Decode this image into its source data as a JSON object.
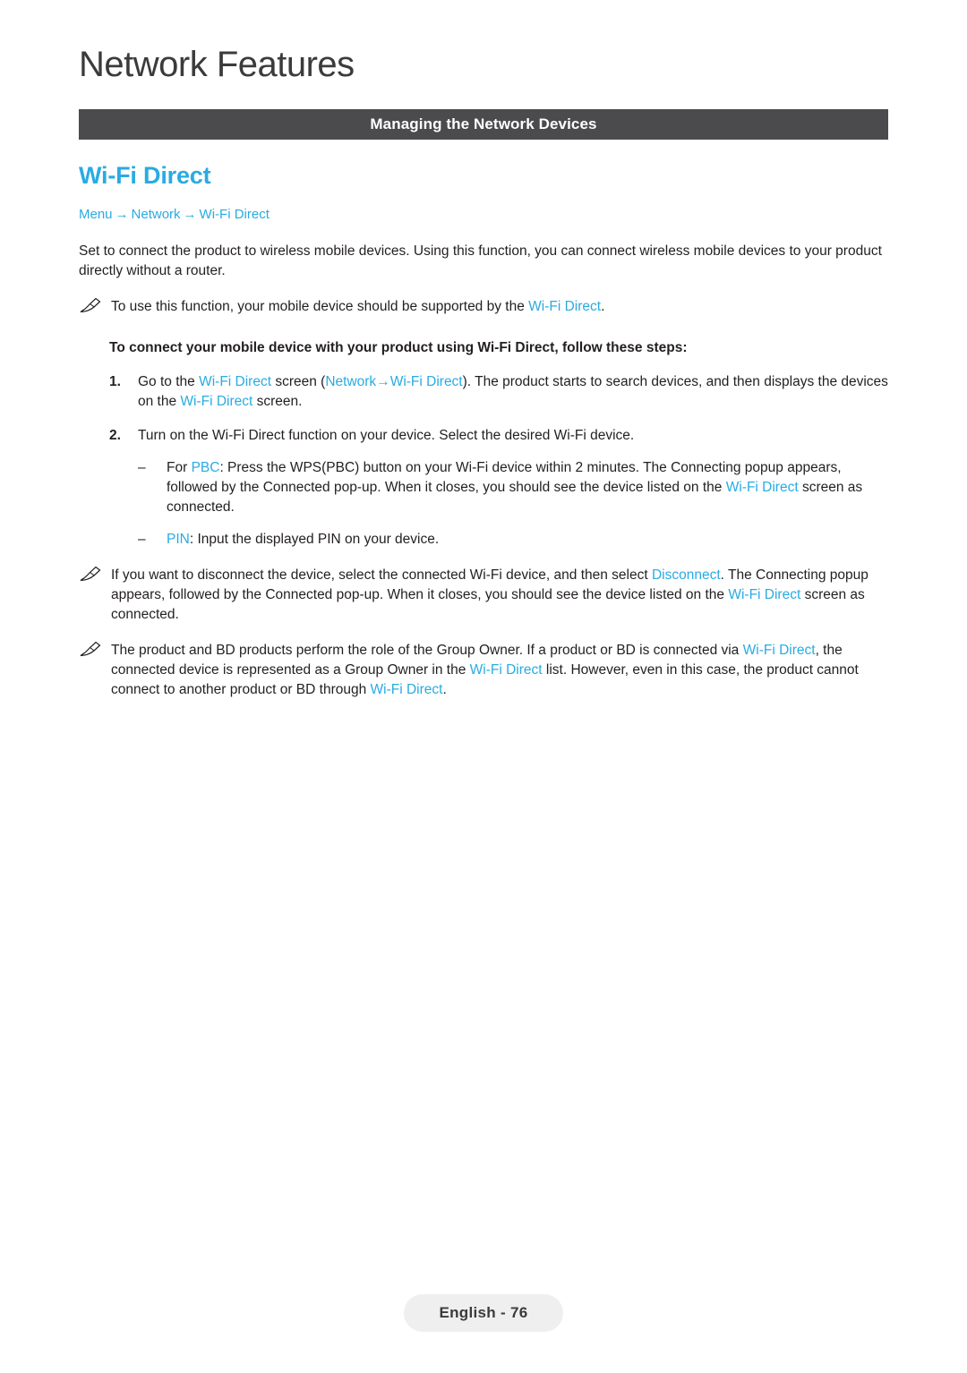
{
  "header": {
    "chapter_title": "Network Features",
    "section_bar": "Managing the Network Devices"
  },
  "topic": {
    "title": "Wi-Fi Direct",
    "breadcrumb": {
      "item1": "Menu",
      "arrow1": "→",
      "item2": "Network",
      "arrow2": "→",
      "item3": "Wi-Fi Direct"
    }
  },
  "body": {
    "intro": "Set to connect the product to wireless mobile devices. Using this function, you can connect wireless mobile devices to your product directly without a router.",
    "note1": {
      "icon": "pencil-note-icon",
      "text_a": "To use this function, your mobile device should be supported by the ",
      "link_a": "Wi-Fi Direct",
      "text_b": "."
    },
    "steps_lead": "To connect your mobile device with your product using Wi-Fi Direct, follow these steps:",
    "step1": {
      "number": "1.",
      "t1": "Go to the ",
      "l1": "Wi-Fi Direct",
      "t2": " screen (",
      "l2": "Network",
      "t3": " ",
      "arrow": "→",
      "t4": " ",
      "l3": "Wi-Fi Direct",
      "t5": "). The product starts to search devices, and then displays the devices on the ",
      "l4": "Wi-Fi Direct",
      "t6": " screen."
    },
    "step2": {
      "number": "2.",
      "text": "Turn on the Wi-Fi Direct function on your device. Select the desired Wi-Fi device."
    },
    "sub1": {
      "dash": "–",
      "t1": "For ",
      "l1": "PBC",
      "t2": ": Press the WPS(PBC) button on your Wi-Fi device within 2 minutes. The Connecting popup appears, followed by the Connected pop-up. When it closes, you should see the device listed on the ",
      "l2": "Wi-Fi Direct",
      "t3": " screen as connected."
    },
    "sub2": {
      "dash": "–",
      "l1": "PIN",
      "t1": ": Input the displayed PIN on your device."
    },
    "note2": {
      "icon": "pencil-note-icon",
      "t1": "If you want to disconnect the device, select the connected Wi-Fi device, and then select ",
      "l1": "Disconnect",
      "t2": ". The Connecting popup appears, followed by the Connected pop-up. When it closes, you should see the device listed on the ",
      "l2": "Wi-Fi Direct",
      "t3": " screen as connected."
    },
    "note3": {
      "icon": "pencil-note-icon",
      "t1": "The product and BD products perform the role of the Group Owner. If a product or BD is connected via ",
      "l1": "Wi-Fi Direct",
      "t2": ", the connected device is represented as a Group Owner in the ",
      "l2": "Wi-Fi Direct",
      "t3": " list. However, even in this case, the product cannot connect to another product or BD through ",
      "l3": "Wi-Fi Direct",
      "t4": "."
    }
  },
  "footer": {
    "page_label": "English - 76"
  },
  "colors": {
    "accent": "#29abe2",
    "bar": "#4b4b4d",
    "text": "#231f20",
    "footer_bg": "#efefef"
  }
}
